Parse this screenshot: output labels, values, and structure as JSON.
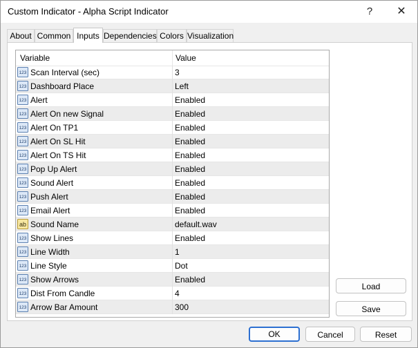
{
  "window": {
    "title": "Custom Indicator - Alpha Script Indicator",
    "help_glyph": "?",
    "close_glyph": "✕"
  },
  "tabs": [
    {
      "label": "About"
    },
    {
      "label": "Common"
    },
    {
      "label": "Inputs",
      "active": true
    },
    {
      "label": "Dependencies"
    },
    {
      "label": "Colors"
    },
    {
      "label": "Visualization"
    }
  ],
  "grid": {
    "header_variable": "Variable",
    "header_value": "Value",
    "rows": [
      {
        "type": "number",
        "name": "Scan Interval (sec)",
        "value": "3"
      },
      {
        "type": "number",
        "name": "Dashboard Place",
        "value": "Left"
      },
      {
        "type": "number",
        "name": "Alert",
        "value": "Enabled"
      },
      {
        "type": "number",
        "name": "Alert On new Signal",
        "value": "Enabled"
      },
      {
        "type": "number",
        "name": "Alert On TP1",
        "value": "Enabled"
      },
      {
        "type": "number",
        "name": "Alert On SL Hit",
        "value": "Enabled"
      },
      {
        "type": "number",
        "name": "Alert On TS Hit",
        "value": "Enabled"
      },
      {
        "type": "number",
        "name": "Pop Up Alert",
        "value": "Enabled"
      },
      {
        "type": "number",
        "name": "Sound Alert",
        "value": "Enabled"
      },
      {
        "type": "number",
        "name": "Push Alert",
        "value": "Enabled"
      },
      {
        "type": "number",
        "name": "Email Alert",
        "value": "Enabled"
      },
      {
        "type": "string",
        "name": "Sound Name",
        "value": "default.wav"
      },
      {
        "type": "number",
        "name": "Show Lines",
        "value": "Enabled"
      },
      {
        "type": "number",
        "name": "Line Width",
        "value": "1"
      },
      {
        "type": "number",
        "name": "Line Style",
        "value": "Dot"
      },
      {
        "type": "number",
        "name": "Show Arrows",
        "value": "Enabled"
      },
      {
        "type": "number",
        "name": "Dist From Candle",
        "value": "4"
      },
      {
        "type": "number",
        "name": "Arrow Bar Amount",
        "value": "300"
      }
    ]
  },
  "icons": {
    "number_text": "123",
    "string_text": "ab"
  },
  "side_buttons": {
    "load": "Load",
    "save": "Save"
  },
  "footer": {
    "ok": "OK",
    "cancel": "Cancel",
    "reset": "Reset"
  }
}
